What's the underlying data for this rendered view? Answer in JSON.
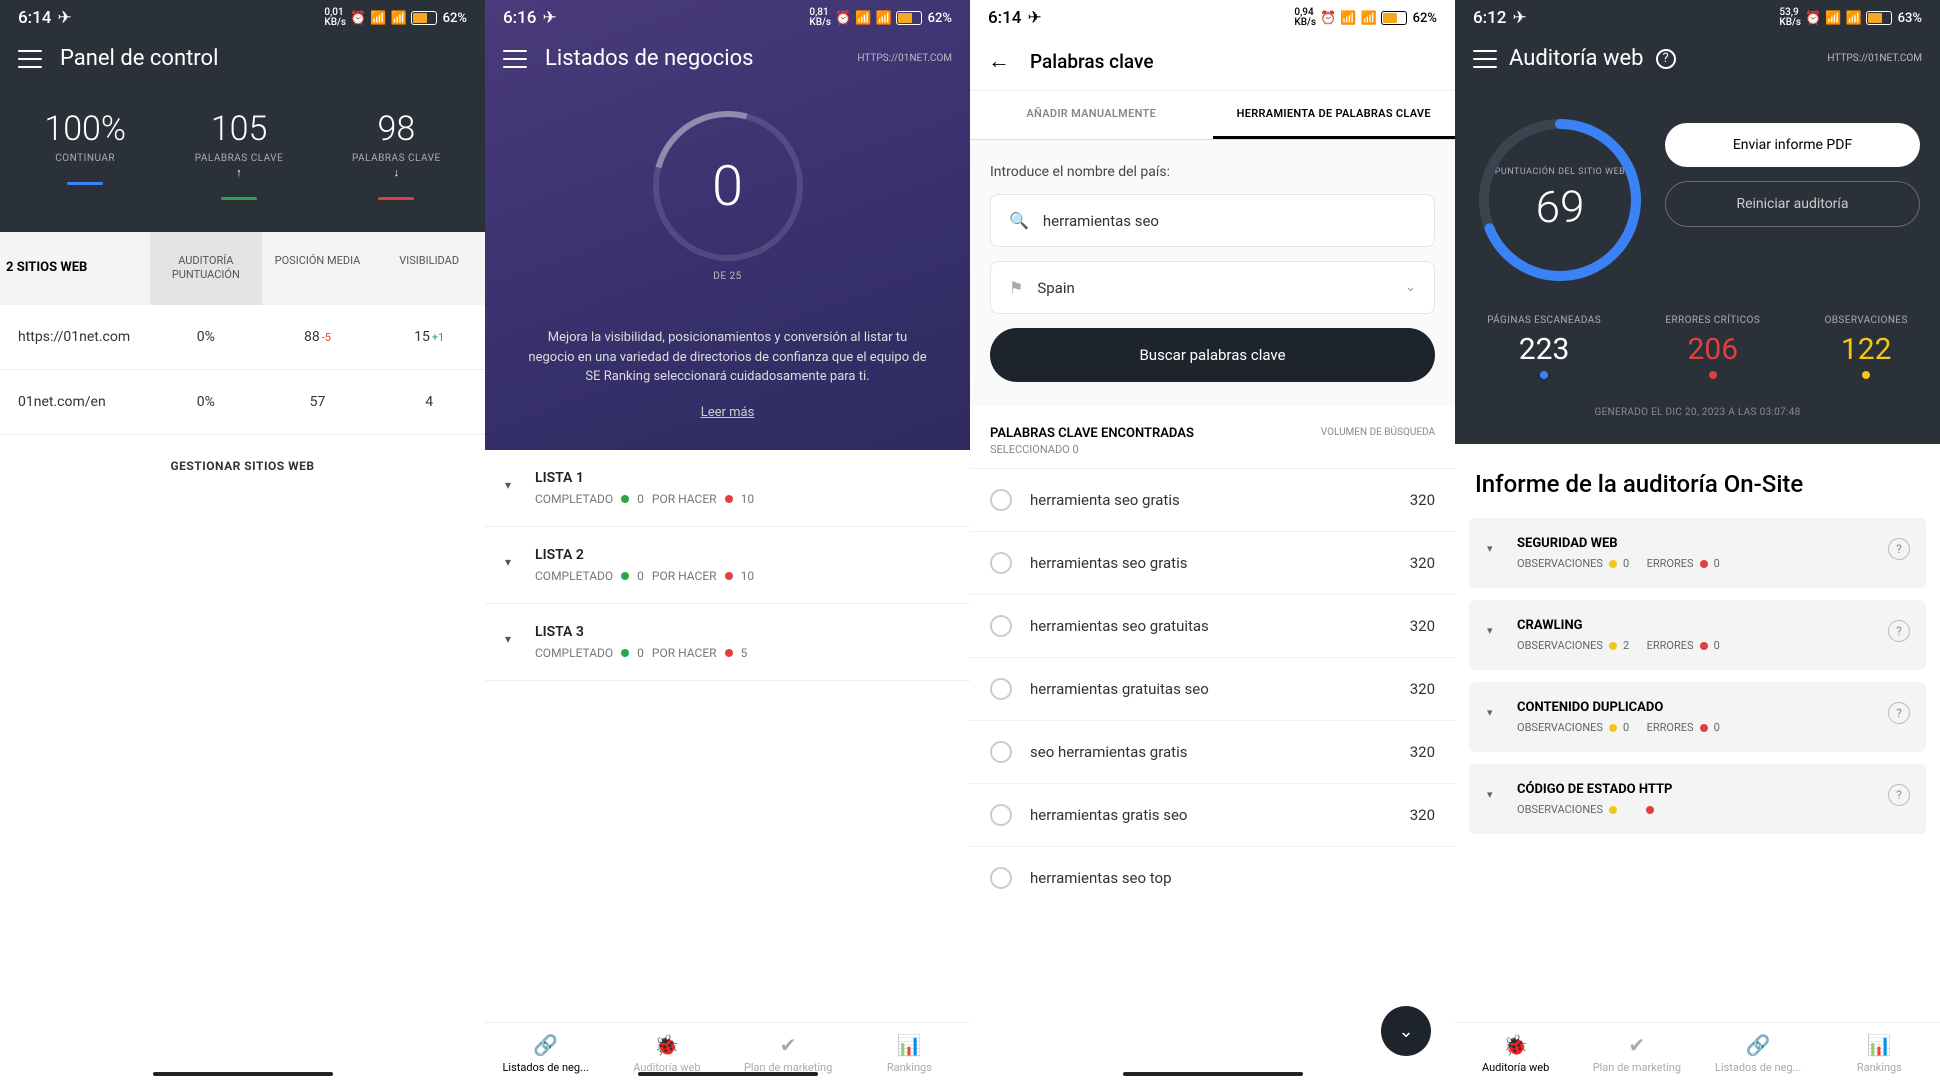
{
  "screen1": {
    "status": {
      "time": "6:14",
      "kbs": "0,01",
      "kbs_unit": "KB/s",
      "battery": "62%"
    },
    "title": "Panel de control",
    "metrics": [
      {
        "value": "100%",
        "label": "CONTINUAR",
        "bar": "#3b82f6"
      },
      {
        "value": "105",
        "label": "PALABRAS CLAVE",
        "icon": "↑",
        "bar": "#29a745"
      },
      {
        "value": "98",
        "label": "PALABRAS CLAVE",
        "icon": "↓",
        "bar": "#e04040"
      }
    ],
    "table": {
      "sites_label": "2 SITIOS WEB",
      "cols": [
        "AUDITORÍA PUNTUACIÓN",
        "POSICIÓN MEDIA",
        "VISIBILIDAD"
      ],
      "rows": [
        {
          "site": "https://01net.com",
          "audit": "0%",
          "pos": "88",
          "pos_delta": "-5",
          "vis": "15",
          "vis_delta": "+1"
        },
        {
          "site": "01net.com/en",
          "audit": "0%",
          "pos": "57",
          "pos_delta": "",
          "vis": "4",
          "vis_delta": ""
        }
      ],
      "manage": "GESTIONAR SITIOS WEB"
    }
  },
  "screen2": {
    "status": {
      "time": "6:16",
      "kbs": "0,81",
      "kbs_unit": "KB/s",
      "battery": "62%"
    },
    "title": "Listados de negocios",
    "url": "HTTPS://01NET.COM",
    "ring": {
      "num": "0",
      "sub": "DE 25"
    },
    "desc": "Mejora la visibilidad, posicionamientos y conversión al listar tu negocio en una variedad de directorios de confianza que el equipo de SE Ranking seleccionará cuidadosamente para ti.",
    "more": "Leer más",
    "lists": [
      {
        "name": "LISTA 1",
        "completed_label": "COMPLETADO",
        "completed": "0",
        "todo_label": "POR HACER",
        "todo": "10"
      },
      {
        "name": "LISTA 2",
        "completed_label": "COMPLETADO",
        "completed": "0",
        "todo_label": "POR HACER",
        "todo": "10"
      },
      {
        "name": "LISTA 3",
        "completed_label": "COMPLETADO",
        "completed": "0",
        "todo_label": "POR HACER",
        "todo": "5"
      }
    ],
    "nav": [
      {
        "label": "Listados de neg...",
        "active": true
      },
      {
        "label": "Auditoría web"
      },
      {
        "label": "Plan de marketing"
      },
      {
        "label": "Rankings"
      }
    ]
  },
  "screen3": {
    "status": {
      "time": "6:14",
      "kbs": "0,94",
      "kbs_unit": "KB/s",
      "battery": "62%"
    },
    "title": "Palabras clave",
    "tabs": [
      "AÑADIR MANUALMENTE",
      "HERRAMIENTA DE PALABRAS CLAVE"
    ],
    "active_tab": 1,
    "form": {
      "label": "Introduce el nombre del país:",
      "search_value": "herramientas seo",
      "country_value": "Spain",
      "button": "Buscar palabras clave"
    },
    "found": {
      "title": "PALABRAS CLAVE ENCONTRADAS",
      "sub": "SELECCIONADO   0",
      "right": "VOLUMEN DE BÚSQUEDA"
    },
    "keywords": [
      {
        "text": "herramienta seo gratis",
        "vol": "320"
      },
      {
        "text": "herramientas seo gratis",
        "vol": "320"
      },
      {
        "text": "herramientas seo gratuitas",
        "vol": "320"
      },
      {
        "text": "herramientas gratuitas seo",
        "vol": "320"
      },
      {
        "text": "seo herramientas gratis",
        "vol": "320"
      },
      {
        "text": "herramientas gratis seo",
        "vol": "320"
      },
      {
        "text": "herramientas seo top",
        "vol": ""
      }
    ]
  },
  "screen4": {
    "status": {
      "time": "6:12",
      "kbs": "53,9",
      "kbs_unit": "KB/s",
      "battery": "63%"
    },
    "title": "Auditoría web",
    "url": "HTTPS://01NET.COM",
    "ring": {
      "label": "PUNTUACIÓN DEL SITIO WEB",
      "num": "69"
    },
    "buttons": {
      "send": "Enviar informe PDF",
      "restart": "Reiniciar auditoría"
    },
    "stats": [
      {
        "label": "PÁGINAS ESCANEADAS",
        "val": "223",
        "color": "#3b82f6"
      },
      {
        "label": "ERRORES CRÍTICOS",
        "val": "206",
        "color": "#e04040"
      },
      {
        "label": "OBSERVACIONES",
        "val": "122",
        "color": "#f5c518"
      }
    ],
    "generated": "GENERADO EL DIC 20, 2023 A LAS 03:07:48",
    "report_title": "Informe de la auditoría On-Site",
    "cards": [
      {
        "title": "SEGURIDAD WEB",
        "obs_label": "OBSERVACIONES",
        "obs": "0",
        "err_label": "ERRORES",
        "err": "0"
      },
      {
        "title": "CRAWLING",
        "obs_label": "OBSERVACIONES",
        "obs": "2",
        "err_label": "ERRORES",
        "err": "0"
      },
      {
        "title": "CONTENIDO DUPLICADO",
        "obs_label": "OBSERVACIONES",
        "obs": "0",
        "err_label": "ERRORES",
        "err": "0"
      },
      {
        "title": "CÓDIGO DE ESTADO HTTP",
        "obs_label": "OBSERVACIONES",
        "obs": "",
        "err_label": "",
        "err": ""
      }
    ],
    "nav": [
      {
        "label": "Auditoría web",
        "active": true
      },
      {
        "label": "Plan de marketing"
      },
      {
        "label": "Listados de neg..."
      },
      {
        "label": "Rankings"
      }
    ]
  }
}
